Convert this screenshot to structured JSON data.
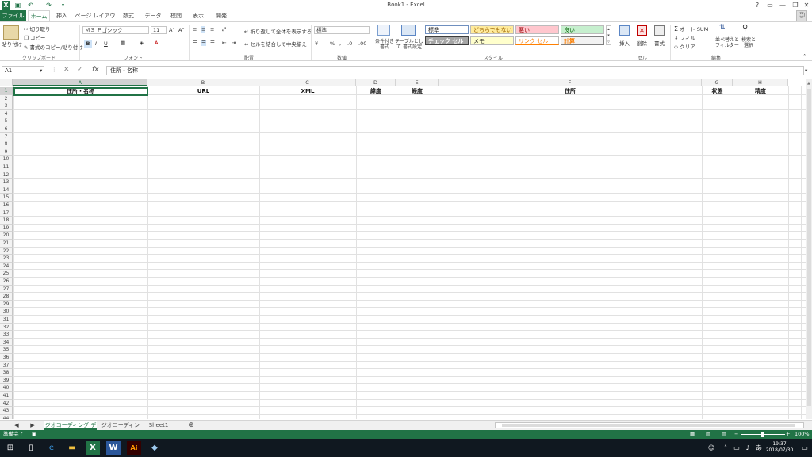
{
  "window": {
    "title": "Book1 - Excel",
    "help": "?"
  },
  "ribbon_tabs": [
    "ファイル",
    "ホーム",
    "挿入",
    "ページ レイアウト",
    "数式",
    "データ",
    "校閲",
    "表示",
    "開発"
  ],
  "clipboard": {
    "paste": "貼り付け",
    "cut": "切り取り",
    "copy": "コピー",
    "format_painter": "書式のコピー/貼り付け",
    "label": "クリップボード"
  },
  "font": {
    "name": "ＭＳ Ｐゴシック",
    "size": "11",
    "bold": "B",
    "italic": "I",
    "underline": "U",
    "label": "フォント"
  },
  "alignment": {
    "wrap": "折り返して全体を表示する",
    "merge": "セルを結合して中央揃え",
    "label": "配置"
  },
  "number": {
    "format": "標準",
    "label": "数値"
  },
  "styles": {
    "conditional": "条件付き 書式",
    "table": "テーブルとして 書式設定",
    "cells": [
      {
        "text": "標準",
        "bg": "#ffffff",
        "fg": "#222222"
      },
      {
        "text": "どちらでもない",
        "bg": "#ffeb9c",
        "fg": "#9c6500"
      },
      {
        "text": "悪い",
        "bg": "#ffc7ce",
        "fg": "#9c0006"
      },
      {
        "text": "良い",
        "bg": "#c6efce",
        "fg": "#006100"
      },
      {
        "text": "チェック セル",
        "bg": "#a5a5a5",
        "fg": "#ffffff"
      },
      {
        "text": "メモ",
        "bg": "#ffffcc",
        "fg": "#222222"
      },
      {
        "text": "リンク セル",
        "bg": "#ffffff",
        "fg": "#fa7d00"
      },
      {
        "text": "計算",
        "bg": "#f2f2f2",
        "fg": "#fa7d00"
      }
    ],
    "label": "スタイル"
  },
  "cells_group": {
    "insert": "挿入",
    "delete": "削除",
    "format": "書式",
    "label": "セル"
  },
  "editing": {
    "autosum": "オート SUM",
    "fill": "フィル",
    "clear": "クリア",
    "sort": "並べ替えと フィルター",
    "find": "検索と 選択",
    "label": "編集"
  },
  "formula_bar": {
    "name_box": "A1",
    "fx": "fx",
    "content": "住所・名称"
  },
  "columns": [
    "A",
    "B",
    "C",
    "D",
    "E",
    "F",
    "G",
    "H"
  ],
  "headers": [
    "住所・名称",
    "URL",
    "XML",
    "緯度",
    "経度",
    "住所",
    "状態",
    "精度"
  ],
  "sheets": [
    "ジオコーディング デモ",
    "ジオコーディング",
    "Sheet1"
  ],
  "status": {
    "ready": "準備完了",
    "zoom": "100%"
  },
  "clock": {
    "time": "19:37",
    "date": "2018/07/30"
  }
}
